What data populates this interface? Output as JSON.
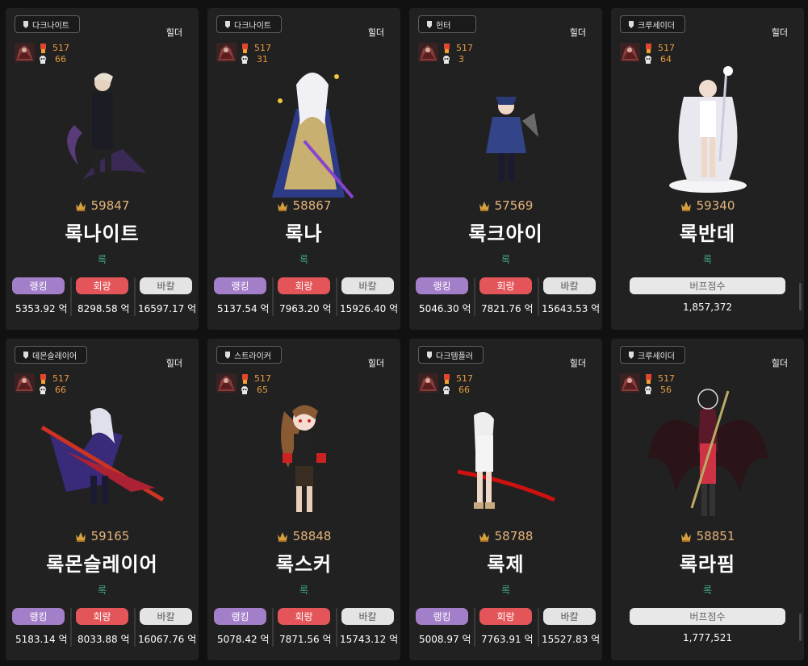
{
  "labels": {
    "rank": "랭킹",
    "heal": "회랑",
    "bakal": "바칼",
    "buff": "버프점수"
  },
  "colors": {
    "level": "#e89a43",
    "fame": "#e3b27a",
    "guild": "#3fa87d",
    "rank_button": "#a47fc9",
    "heal_button": "#e4555a",
    "bakal_button": "#e4e4e4"
  },
  "cards": [
    {
      "job": "다크나이트",
      "server": "힐더",
      "level": "517",
      "sub": "66",
      "fame": "59847",
      "name": "록나이트",
      "guild": "록",
      "type": "dealer",
      "rank": "5353.92 억",
      "heal": "8298.58 억",
      "bakal": "16597.17 억"
    },
    {
      "job": "다크나이트",
      "server": "힐더",
      "level": "517",
      "sub": "31",
      "fame": "58867",
      "name": "록나",
      "guild": "록",
      "type": "dealer",
      "rank": "5137.54 억",
      "heal": "7963.20 억",
      "bakal": "15926.40 억"
    },
    {
      "job": "헌터",
      "server": "힐더",
      "level": "517",
      "sub": "3",
      "fame": "57569",
      "name": "록크아이",
      "guild": "록",
      "type": "dealer",
      "rank": "5046.30 억",
      "heal": "7821.76 억",
      "bakal": "15643.53 억"
    },
    {
      "job": "크루세이더",
      "server": "힐더",
      "level": "517",
      "sub": "64",
      "fame": "59340",
      "name": "록반데",
      "guild": "록",
      "type": "buffer",
      "buff": "1,857,372"
    },
    {
      "job": "데몬슬레이어",
      "server": "힐더",
      "level": "517",
      "sub": "66",
      "fame": "59165",
      "name": "록몬슬레이어",
      "guild": "록",
      "type": "dealer",
      "rank": "5183.14 억",
      "heal": "8033.88 억",
      "bakal": "16067.76 억"
    },
    {
      "job": "스트라이커",
      "server": "힐더",
      "level": "517",
      "sub": "65",
      "fame": "58848",
      "name": "록스커",
      "guild": "록",
      "type": "dealer",
      "rank": "5078.42 억",
      "heal": "7871.56 억",
      "bakal": "15743.12 억"
    },
    {
      "job": "다크템플러",
      "server": "힐더",
      "level": "517",
      "sub": "66",
      "fame": "58788",
      "name": "록제",
      "guild": "록",
      "type": "dealer",
      "rank": "5008.97 억",
      "heal": "7763.91 억",
      "bakal": "15527.83 억"
    },
    {
      "job": "크루세이더",
      "server": "힐더",
      "level": "517",
      "sub": "56",
      "fame": "58851",
      "name": "록라핌",
      "guild": "록",
      "type": "buffer",
      "buff": "1,777,521"
    }
  ]
}
